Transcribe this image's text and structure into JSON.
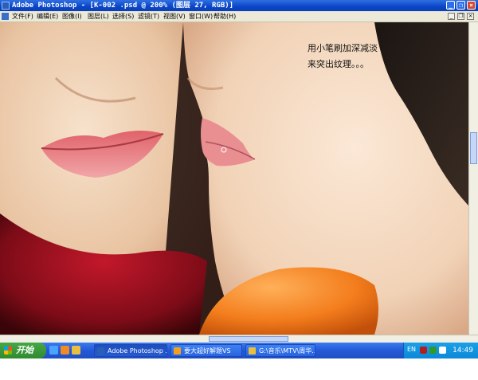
{
  "window": {
    "title": "Adobe Photoshop - [K-002 .psd @ 200% (图层 27, RGB)]",
    "minimize_glyph": "_",
    "restore_glyph": "❐",
    "close_glyph": "×"
  },
  "menu": {
    "items": [
      "文件(F)",
      "编辑(E)",
      "图像(I)",
      "图层(L)",
      "选择(S)",
      "滤镜(T)",
      "视图(V)",
      "窗口(W)",
      "帮助(H)"
    ],
    "controls": [
      "_",
      "❐",
      "×"
    ]
  },
  "annotation": {
    "line1": "用小笔刷加深减淡",
    "line2": "来突出纹理。。。"
  },
  "taskbar": {
    "start_label": "开始",
    "tasks": [
      {
        "label": "Adobe Photoshop ...",
        "icon": "photoshop-icon",
        "color": "#2a5fb8"
      },
      {
        "label": "要大超好解题VS",
        "icon": "media-player-icon",
        "color": "#f0a020"
      },
      {
        "label": "G:\\音乐\\MTV\\周华...",
        "icon": "folder-icon",
        "color": "#e8c040"
      }
    ],
    "language": "EN",
    "clock": "14:49"
  },
  "colors": {
    "titlebar": "#0a46c9",
    "taskbar": "#2458d6",
    "start_button": "#2f8b2f",
    "tray": "#0c88d8",
    "background": "#e8c8a8"
  }
}
